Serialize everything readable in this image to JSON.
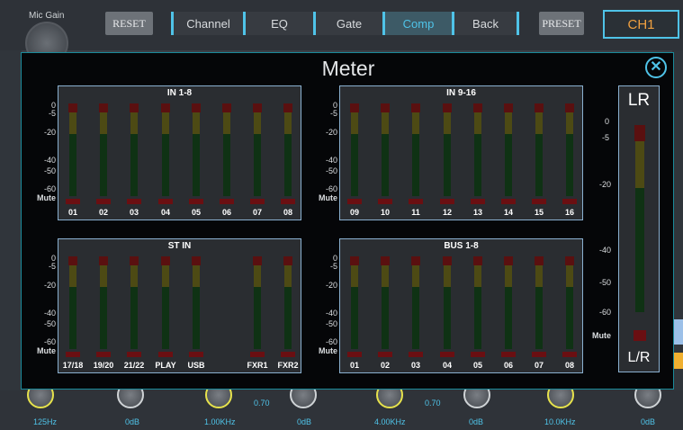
{
  "topbar": {
    "mic_gain": "Mic Gain",
    "reset": "RESET",
    "tabs": [
      "Channel",
      "EQ",
      "Gate",
      "Comp",
      "Back"
    ],
    "active_tab": "Comp",
    "preset": "PRESET",
    "channel": "CH1"
  },
  "meter_panel": {
    "title": "Meter",
    "scale": [
      "0",
      "-5",
      "-20",
      "-40",
      "-50",
      "-60"
    ],
    "mute_label": "Mute",
    "groups": [
      {
        "title": "IN 1-8",
        "channels": [
          "01",
          "02",
          "03",
          "04",
          "05",
          "06",
          "07",
          "08"
        ]
      },
      {
        "title": "IN 9-16",
        "channels": [
          "09",
          "10",
          "11",
          "12",
          "13",
          "14",
          "15",
          "16"
        ]
      },
      {
        "title": "ST IN",
        "channels": [
          "17/18",
          "19/20",
          "21/22",
          "PLAY",
          "USB",
          "",
          "FXR1",
          "FXR2"
        ]
      },
      {
        "title": "BUS 1-8",
        "channels": [
          "01",
          "02",
          "03",
          "04",
          "05",
          "06",
          "07",
          "08"
        ]
      }
    ],
    "lr": {
      "title": "LR",
      "label": "L/R",
      "scale": [
        "0",
        "-5",
        "-20",
        "-40",
        "-50",
        "-60"
      ],
      "mute_label": "Mute"
    }
  },
  "bottom": {
    "labels": [
      "125Hz",
      "0dB",
      "1.00KHz",
      "0dB",
      "4.00KHz",
      "0dB",
      "10.0KHz",
      "0dB"
    ],
    "values": [
      "0.70",
      "0.70"
    ]
  },
  "colors": {
    "accent": "#4fc3e8",
    "channel": "#f0a040",
    "meter_red": "#5a1010",
    "meter_yellow": "#4d4a14",
    "meter_green": "#0f3214"
  }
}
